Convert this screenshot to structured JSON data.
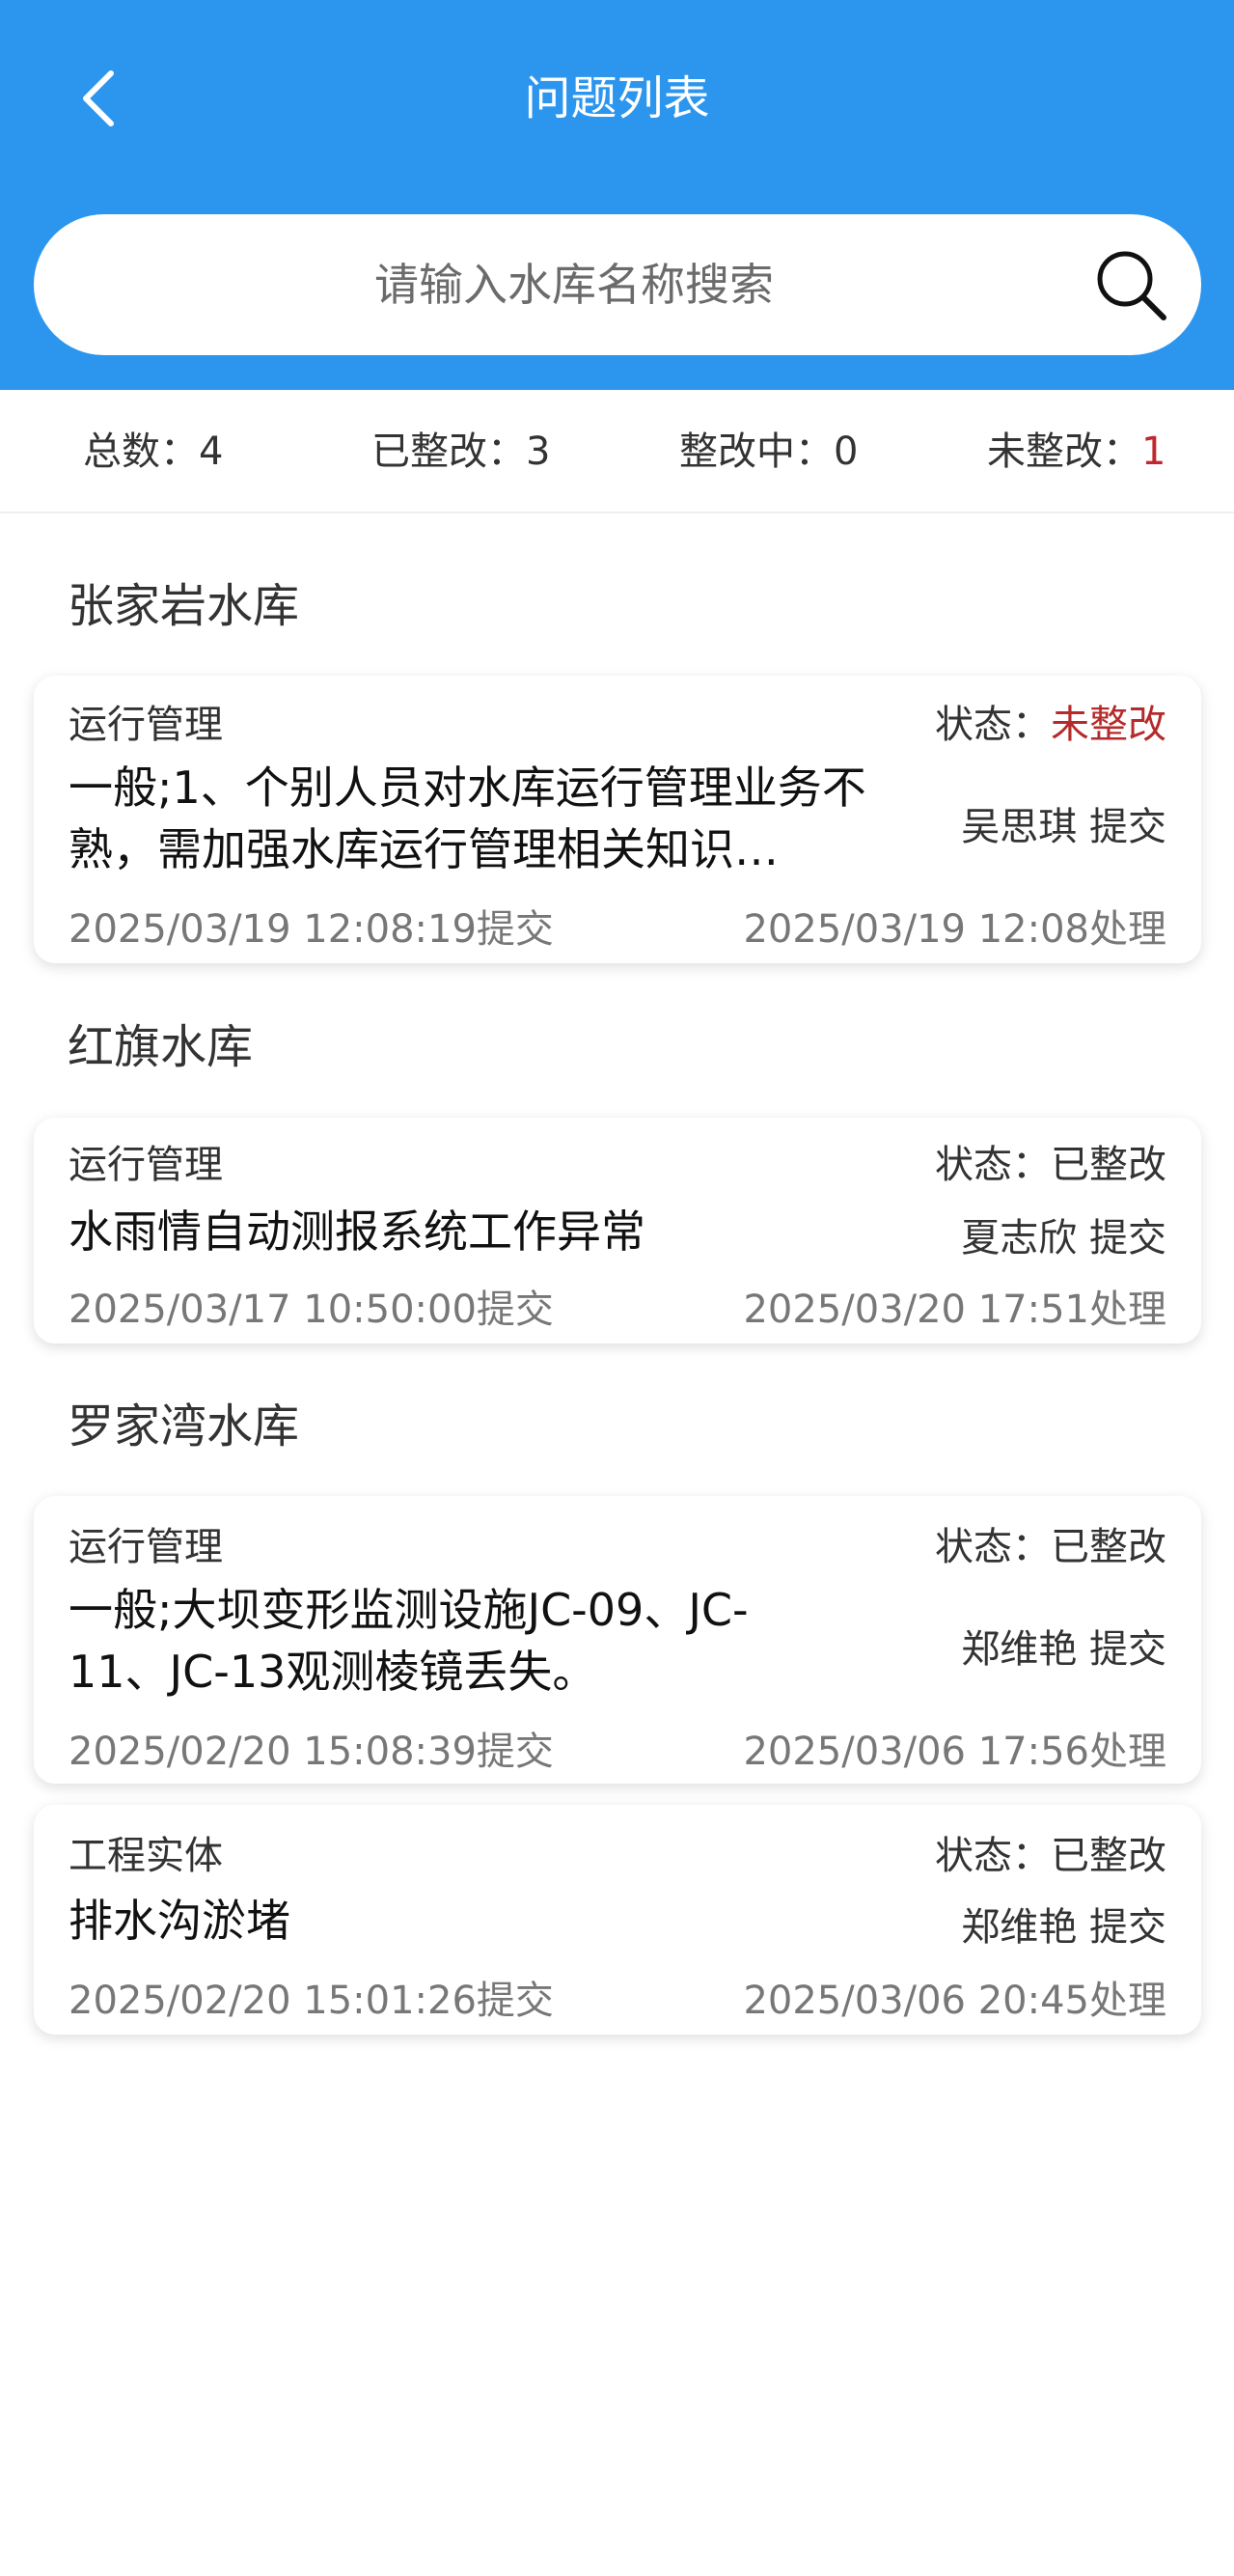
{
  "header": {
    "title": "问题列表"
  },
  "search": {
    "placeholder": "请输入水库名称搜索"
  },
  "stats": {
    "total_label": "总数：",
    "total": "4",
    "fixed_label": "已整改：",
    "fixed": "3",
    "fixing_label": "整改中：",
    "fixing": "0",
    "unfixed_label": "未整改：",
    "unfixed": "1"
  },
  "groups": [
    {
      "reservoir": "张家岩水库",
      "issues": [
        {
          "category": "运行管理",
          "status_label": "状态：",
          "status": "未整改",
          "description": "一般;1、个别人员对水库运行管理业务不熟，需加强水库运行管理相关知识…",
          "submitter": "吴思琪 提交",
          "submitted_at": "2025/03/19 12:08:19提交",
          "processed_at": "2025/03/19 12:08处理"
        }
      ]
    },
    {
      "reservoir": "红旗水库",
      "issues": [
        {
          "category": "运行管理",
          "status_label": "状态：",
          "status": "已整改",
          "description": "水雨情自动测报系统工作异常",
          "submitter": "夏志欣 提交",
          "submitted_at": "2025/03/17 10:50:00提交",
          "processed_at": "2025/03/20 17:51处理"
        }
      ]
    },
    {
      "reservoir": "罗家湾水库",
      "issues": [
        {
          "category": "运行管理",
          "status_label": "状态：",
          "status": "已整改",
          "description": "一般;大坝变形监测设施JC-09、JC-11、JC-13观测棱镜丢失。",
          "submitter": "郑维艳 提交",
          "submitted_at": "2025/02/20 15:08:39提交",
          "processed_at": "2025/03/06 17:56处理"
        },
        {
          "category": "工程实体",
          "status_label": "状态：",
          "status": "已整改",
          "description": "排水沟淤堵",
          "submitter": "郑维艳 提交",
          "submitted_at": "2025/02/20 15:01:26提交",
          "processed_at": "2025/03/06 20:45处理"
        }
      ]
    }
  ],
  "colors": {
    "header_bg": "#2c96ef",
    "alert_red": "#b52a2a"
  },
  "icons": {
    "back": "chevron-left-icon",
    "search": "search-icon"
  }
}
